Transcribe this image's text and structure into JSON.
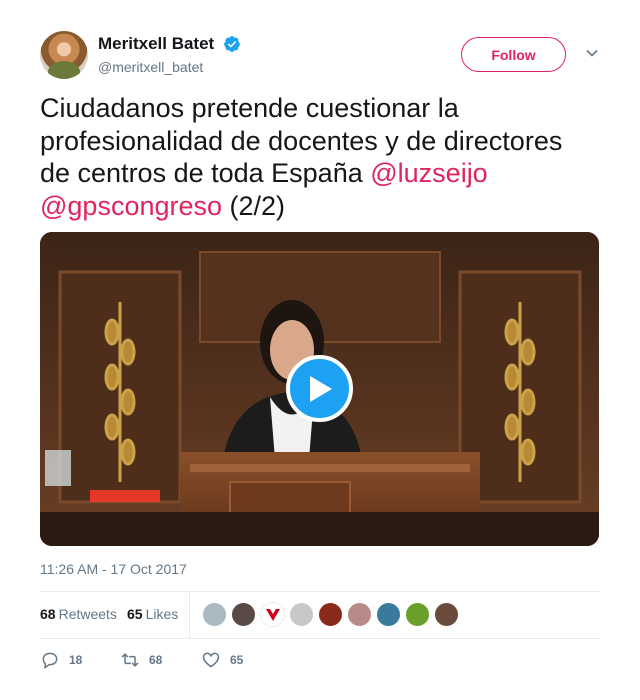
{
  "author": {
    "name": "Meritxell Batet",
    "handle": "@meritxell_batet",
    "follow_label": "Follow"
  },
  "tweet": {
    "text_line1": "Ciudadanos pretende cuestionar la",
    "text_line2": "profesionalidad de docentes y de directores",
    "text_line3_prefix": "de centros de toda España ",
    "mention1": "@luzseijo",
    "mention2": "@gpscongreso",
    "text_suffix": " (2/2)"
  },
  "timestamp": "11:26 AM - 17 Oct 2017",
  "stats": {
    "retweets_count": "68",
    "retweets_label": "Retweets",
    "likes_count": "65",
    "likes_label": "Likes"
  },
  "actions": {
    "reply_count": "18",
    "retweet_count": "68",
    "like_count": "65"
  },
  "colors": {
    "accent": "#e0245e",
    "play": "#1da1f2",
    "muted": "#657786"
  }
}
